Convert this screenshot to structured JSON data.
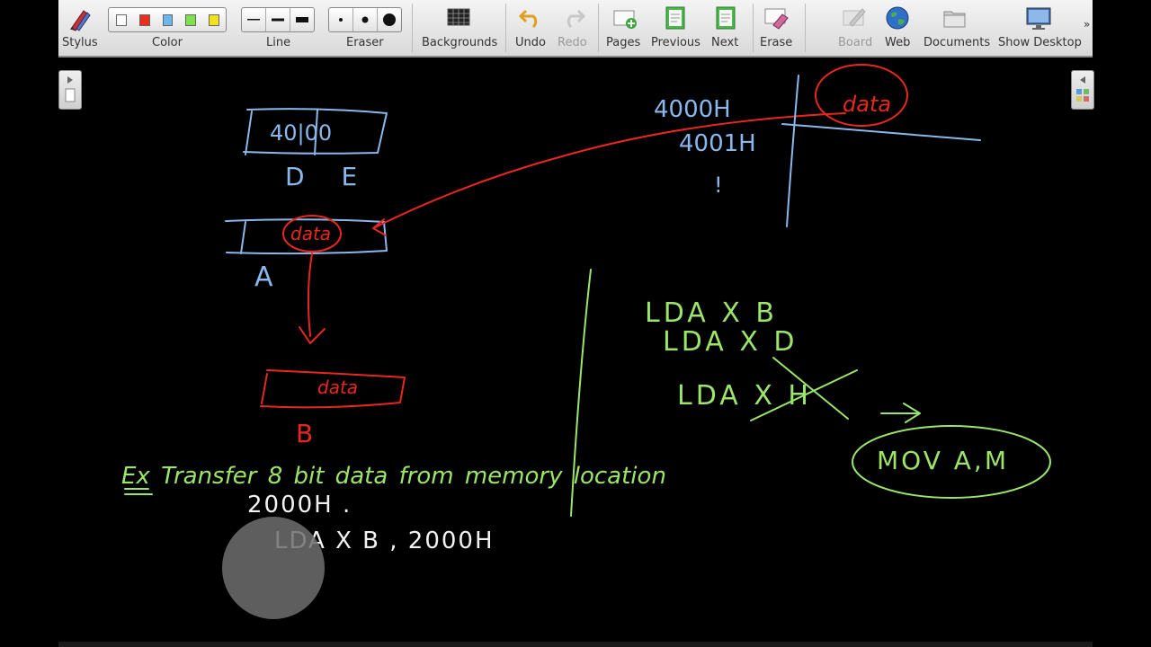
{
  "toolbar": {
    "stylus": "Stylus",
    "color": "Color",
    "line": "Line",
    "eraser": "Eraser",
    "backgrounds": "Backgrounds",
    "undo": "Undo",
    "redo": "Redo",
    "pages": "Pages",
    "previous": "Previous",
    "next": "Next",
    "erase": "Erase",
    "board": "Board",
    "web": "Web",
    "documents": "Documents",
    "show_desktop": "Show Desktop",
    "more": "»"
  },
  "palette_colors": [
    "#ffffff",
    "#e8301c",
    "#6ab7f0",
    "#7ee04a",
    "#f2e21b"
  ],
  "ink_colors": {
    "blue": "#8ab8ec",
    "red": "#e8281e",
    "green": "#9be56a",
    "white": "#f2f2f2"
  },
  "board": {
    "reg_de_value": "40|00",
    "reg_de_labels": "D  E",
    "reg_a_content": "data",
    "reg_a_label": "A",
    "reg_b_content": "data",
    "reg_b_label": "B",
    "mem_addr_1": "4000H",
    "mem_addr_2": "4001H",
    "mem_dots": "!",
    "mem_content": "data",
    "instr_1": "LDA X  B",
    "instr_2": "LDA X  D",
    "instr_3": "LDA X  H",
    "mov_instr": "MOV A,M",
    "example_line": "Ex  Transfer  8 bit data from  memory location",
    "example_addr": "2000H .",
    "example_code": "LDA X  B , 2000H"
  }
}
